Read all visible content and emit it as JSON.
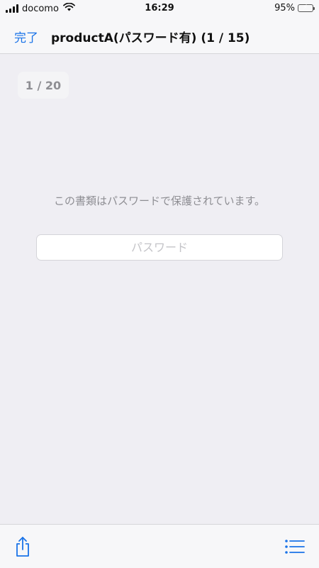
{
  "status_bar": {
    "carrier": "docomo",
    "time": "16:29",
    "battery_percent": "95%",
    "battery_level": 0.95,
    "battery_color": "#34c759",
    "icons": [
      "signal-icon",
      "wifi-icon",
      "battery-charging-icon"
    ]
  },
  "nav": {
    "done_label": "完了",
    "title": "productA(パスワード有) (1 / 15)",
    "accent_color": "#1a73e8"
  },
  "page_indicator": {
    "text": "1 / 20"
  },
  "main": {
    "message": "この書類はパスワードで保護されています。",
    "password_placeholder": "パスワード",
    "password_value": ""
  },
  "toolbar": {
    "icons": [
      "share-icon",
      "list-icon"
    ]
  }
}
